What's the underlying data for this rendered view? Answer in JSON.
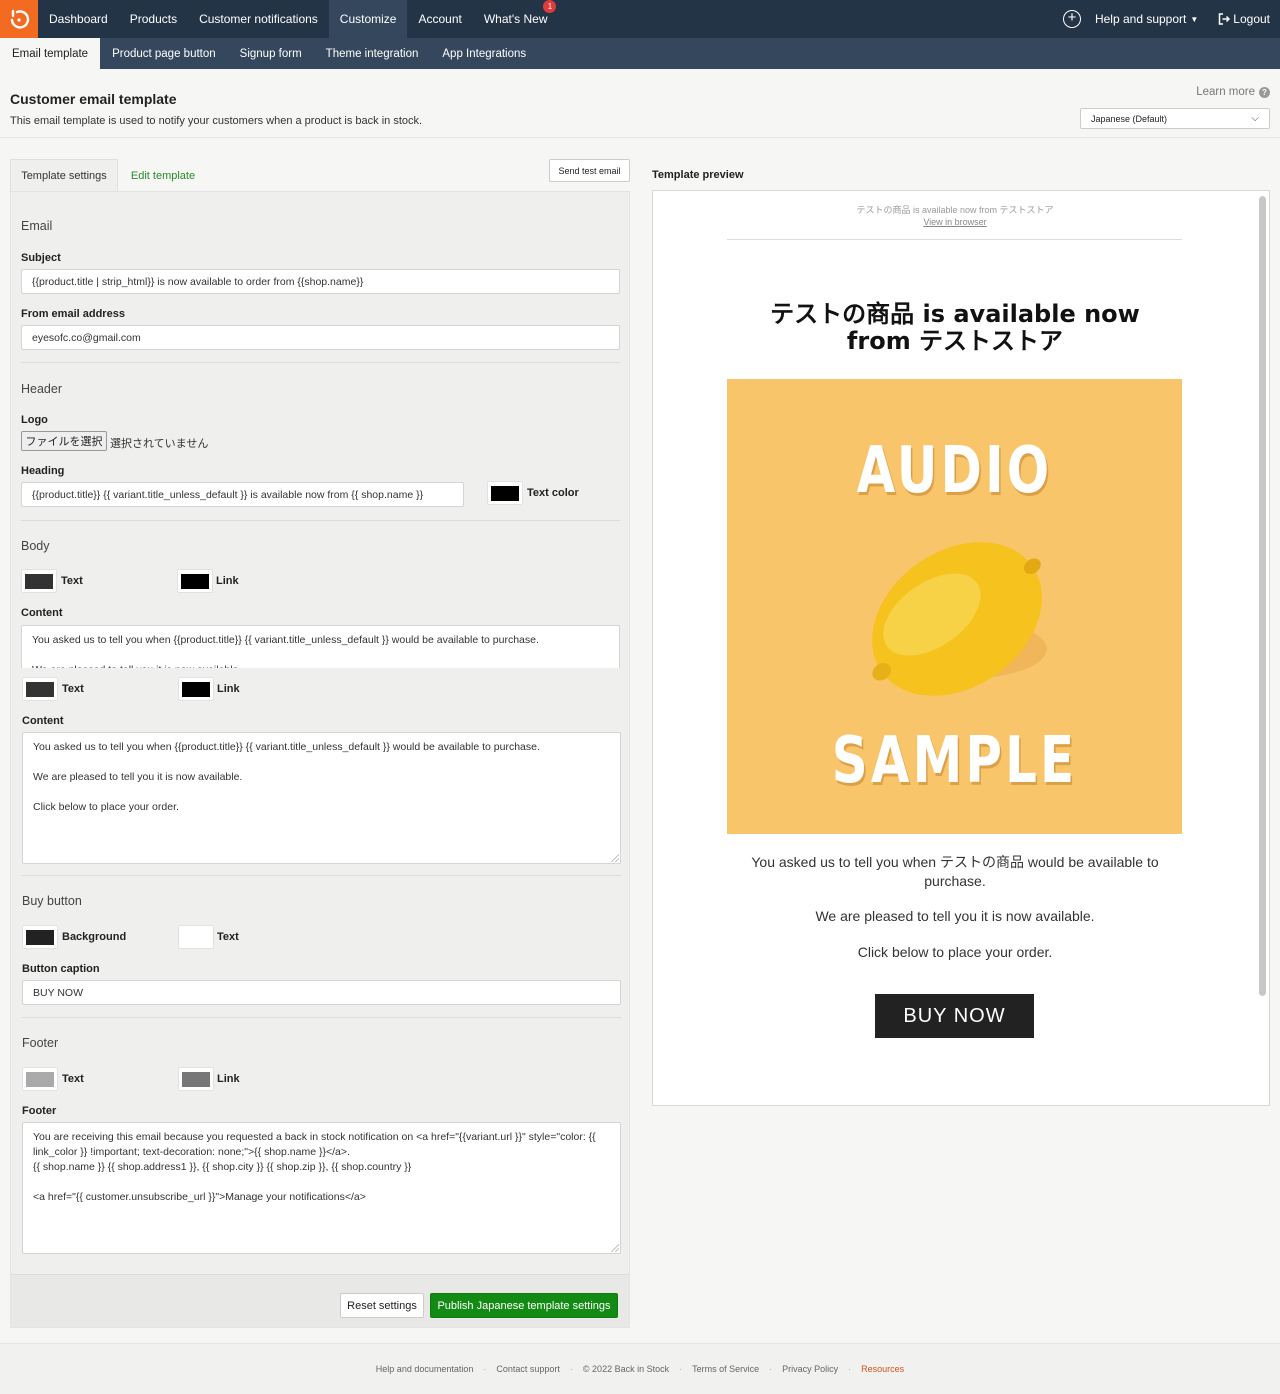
{
  "nav": {
    "items": [
      "Dashboard",
      "Products",
      "Customer notifications",
      "Customize",
      "Account",
      "What's New"
    ],
    "whats_new_badge": "1",
    "help": "Help and support",
    "logout": "Logout"
  },
  "subnav": {
    "tabs": [
      "Email template",
      "Product page button",
      "Signup form",
      "Theme integration",
      "App Integrations"
    ]
  },
  "page": {
    "title": "Customer email template",
    "description": "This email template is used to notify your customers when a product is back in stock.",
    "learn_more": "Learn more",
    "language": "Japanese (Default)"
  },
  "panel": {
    "tab_settings": "Template settings",
    "tab_edit": "Edit template",
    "send_test": "Send test email",
    "email_section": "Email",
    "subject_label": "Subject",
    "subject_value": "{{product.title | strip_html}} is now available to order from {{shop.name}}",
    "from_label": "From email address",
    "from_value": "eyesofc.co@gmail.com",
    "header_section": "Header",
    "logo_label": "Logo",
    "file_button": "ファイルを選択",
    "file_none": "選択されていません",
    "heading_label": "Heading",
    "heading_value": "{{product.title}} {{ variant.title_unless_default }} is available now from {{ shop.name }}",
    "text_color_label": "Text color",
    "body_section": "Body",
    "text_label": "Text",
    "link_label": "Link",
    "content_label": "Content",
    "content_line1": "You asked us to tell you when {{product.title}} {{ variant.title_unless_default }} would be available to purchase.",
    "content_line2": "We are pleased to tell you it is now available.",
    "content_line3": "Click below to place your order.",
    "buy_section": "Buy button",
    "background_label": "Background",
    "caption_label": "Button caption",
    "caption_value": "BUY NOW",
    "footer_section": "Footer",
    "footer_label": "Footer",
    "footer_line1": "You are receiving this email because you requested a back in stock notification on <a href=\"{{variant.url }}\" style=\"color: {{",
    "footer_line2": "link_color }} !important; text-decoration: none;\">{{ shop.name }}</a>.",
    "footer_line3": "{{ shop.name }} {{ shop.address1 }}, {{ shop.city }} {{ shop.zip }}, {{ shop.country }}",
    "footer_line4": "<a href=\"{{ customer.unsubscribe_url }}\">Manage your notifications</a>",
    "reset": "Reset settings",
    "publish": "Publish Japanese template settings"
  },
  "colors": {
    "heading_text": "#000000",
    "body_text": "#333333",
    "body_link": "#000000",
    "button_bg": "#222222",
    "button_text": "#ffffff",
    "footer_text": "#aaaaaa",
    "footer_link": "#777777",
    "accent_green": "#138a13",
    "brand_orange": "#f26b21"
  },
  "preview": {
    "label": "Template preview",
    "preheader": "テストの商品 is available now from テストストア",
    "view_in_browser": "View in browser",
    "heading": "テストの商品 is available now from テストストア",
    "image_word_top": "AUDIO",
    "image_word_bottom": "SAMPLE",
    "body1": "You asked us to tell you when テストの商品 would be available to purchase.",
    "body2": "We are pleased to tell you it is now available.",
    "body3": "Click below to place your order.",
    "button": "BUY NOW"
  },
  "footer": {
    "links": [
      "Help and documentation",
      "Contact support",
      "© 2022 Back in Stock",
      "Terms of Service",
      "Privacy Policy",
      "Resources"
    ]
  }
}
